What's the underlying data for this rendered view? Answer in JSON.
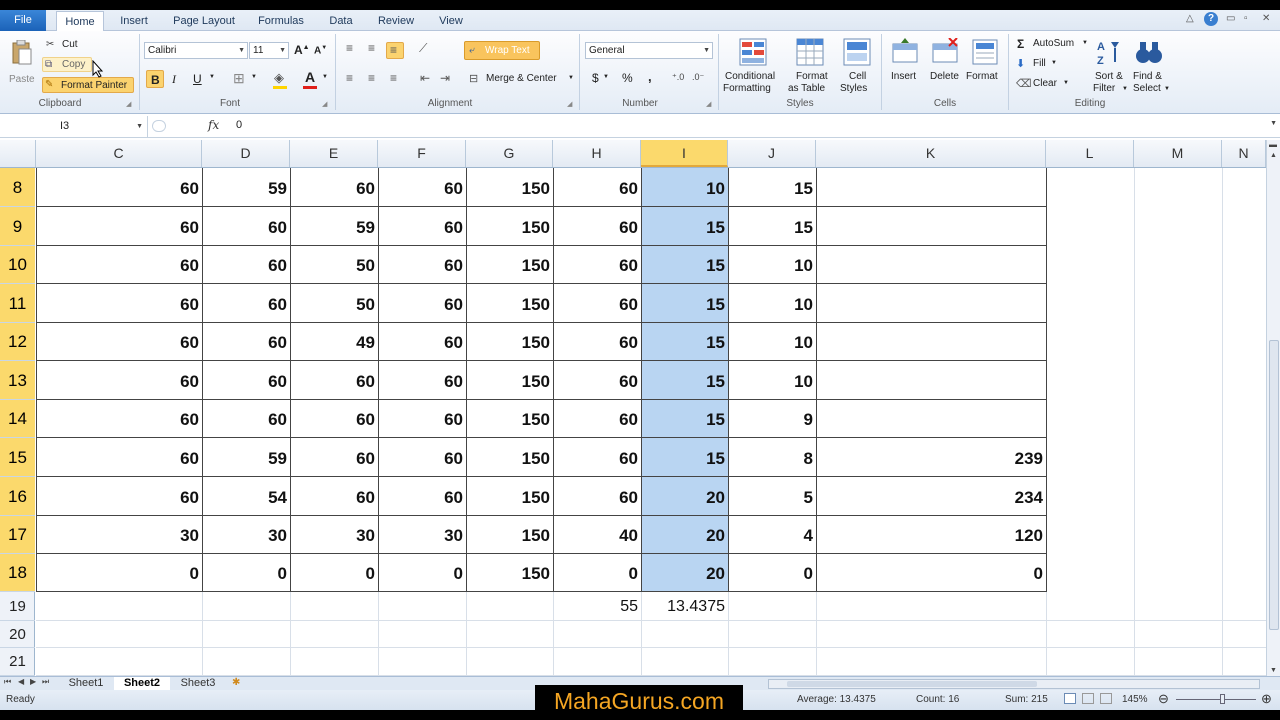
{
  "ribbon": {
    "tabs": [
      "File",
      "Home",
      "Insert",
      "Page Layout",
      "Formulas",
      "Data",
      "Review",
      "View"
    ],
    "clipboard": {
      "paste": "Paste",
      "cut": "Cut",
      "copy": "Copy",
      "format_painter": "Format Painter",
      "label": "Clipboard"
    },
    "font": {
      "name": "Calibri",
      "size": "11",
      "label": "Font"
    },
    "alignment": {
      "wrap_text": "Wrap Text",
      "merge_center": "Merge & Center",
      "label": "Alignment"
    },
    "number": {
      "format": "General",
      "dollar": "$",
      "percent": "%",
      "comma": ",",
      "label": "Number"
    },
    "styles": {
      "conditional_1": "Conditional",
      "conditional_2": "Formatting",
      "format_table_1": "Format",
      "format_table_2": "as Table",
      "cell_styles_1": "Cell",
      "cell_styles_2": "Styles",
      "label": "Styles"
    },
    "cells": {
      "insert": "Insert",
      "delete": "Delete",
      "format": "Format",
      "label": "Cells"
    },
    "editing": {
      "autosum": "AutoSum",
      "fill": "Fill",
      "clear": "Clear",
      "sort_1": "Sort &",
      "sort_2": "Filter",
      "find_1": "Find &",
      "find_2": "Select",
      "label": "Editing"
    }
  },
  "formula_bar": {
    "name_box": "I3",
    "fx": "fx",
    "value": "0"
  },
  "columns": [
    "C",
    "D",
    "E",
    "F",
    "G",
    "H",
    "I",
    "J",
    "K",
    "L",
    "M",
    "N"
  ],
  "rows": [
    "8",
    "9",
    "10",
    "11",
    "12",
    "13",
    "14",
    "15",
    "16",
    "17",
    "18",
    "19",
    "20",
    "21"
  ],
  "table": [
    [
      "60",
      "59",
      "60",
      "60",
      "150",
      "60",
      "10",
      "15",
      ""
    ],
    [
      "60",
      "60",
      "59",
      "60",
      "150",
      "60",
      "15",
      "15",
      ""
    ],
    [
      "60",
      "60",
      "50",
      "60",
      "150",
      "60",
      "15",
      "10",
      ""
    ],
    [
      "60",
      "60",
      "50",
      "60",
      "150",
      "60",
      "15",
      "10",
      ""
    ],
    [
      "60",
      "60",
      "49",
      "60",
      "150",
      "60",
      "15",
      "10",
      ""
    ],
    [
      "60",
      "60",
      "60",
      "60",
      "150",
      "60",
      "15",
      "10",
      ""
    ],
    [
      "60",
      "60",
      "60",
      "60",
      "150",
      "60",
      "15",
      "9",
      ""
    ],
    [
      "60",
      "59",
      "60",
      "60",
      "150",
      "60",
      "15",
      "8",
      "239"
    ],
    [
      "60",
      "54",
      "60",
      "60",
      "150",
      "60",
      "20",
      "5",
      "234"
    ],
    [
      "30",
      "30",
      "30",
      "30",
      "150",
      "40",
      "20",
      "4",
      "120"
    ],
    [
      "0",
      "0",
      "0",
      "0",
      "150",
      "0",
      "20",
      "0",
      "0"
    ]
  ],
  "totals_row": {
    "h": "55",
    "i": "13.4375"
  },
  "sheets": [
    "Sheet1",
    "Sheet2",
    "Sheet3"
  ],
  "status": {
    "ready": "Ready",
    "average": "Average: 13.4375",
    "count": "Count: 16",
    "sum": "Sum: 215",
    "zoom": "145%"
  },
  "watermark": "MahaGurus.com",
  "colors": {
    "selected_col": "#b9d5f2",
    "header_highlight": "#fbd96c",
    "wrap_text_active": "#f9c45d",
    "file_tab": "#1b62b8",
    "watermark": "#f5a623"
  }
}
